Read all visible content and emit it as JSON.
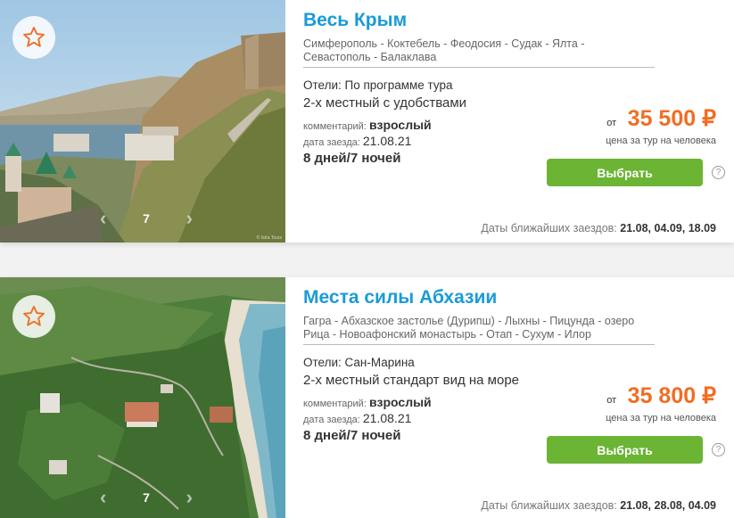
{
  "tours": [
    {
      "title": "Весь Крым",
      "route": "Симферополь - Коктебель - Феодосия - Судак - Ялта - Севастополь - Балаклава",
      "hotels": "Отели: По программе тура",
      "room": "2-х местный с удобствами",
      "comment_label": "комментарий:",
      "comment_value": "взрослый",
      "date_label": "дата заезда:",
      "date_value": "21.08.21",
      "duration": "8 дней/7 ночей",
      "price_prefix": "от",
      "price": "35 500 ₽",
      "price_note": "цена за тур на человека",
      "select_label": "Выбрать",
      "help_label": "?",
      "upcoming_label": "Даты ближайших заездов:",
      "upcoming_dates": "21.08, 04.09, 18.09",
      "photo_count": "7",
      "photo_credit": "© Istra Tours"
    },
    {
      "title": "Места силы Абхазии",
      "route": "Гагра - Абхазское застолье (Дурипш) - Лыхны - Пицунда - озеро Рица - Новоафонский монастырь - Отап - Сухум - Илор",
      "hotels": "Отели: Сан-Марина",
      "room": "2-х местный стандарт вид на море",
      "comment_label": "комментарий:",
      "comment_value": "взрослый",
      "date_label": "дата заезда:",
      "date_value": "21.08.21",
      "duration": "8 дней/7 ночей",
      "price_prefix": "от",
      "price": "35 800 ₽",
      "price_note": "цена за тур на человека",
      "select_label": "Выбрать",
      "help_label": "?",
      "upcoming_label": "Даты ближайших заездов:",
      "upcoming_dates": "21.08, 28.08, 04.09",
      "photo_count": "7"
    }
  ],
  "icons": {
    "favorite": "star-outline-icon",
    "prev": "chevron-left-icon",
    "next": "chevron-right-icon",
    "help": "question-circle-icon"
  },
  "colors": {
    "title": "#1a9bd7",
    "price": "#f26d22",
    "button": "#6bb434"
  }
}
